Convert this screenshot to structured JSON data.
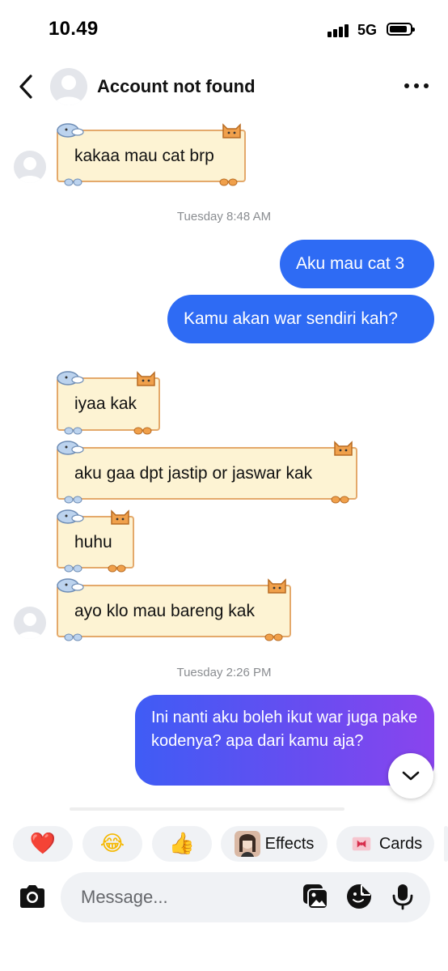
{
  "status": {
    "time": "10.49",
    "network": "5G"
  },
  "header": {
    "title": "Account not found"
  },
  "messages": {
    "m1": "kakaa mau cat brp",
    "ts1": "Tuesday 8:48 AM",
    "m2": "Aku mau cat 3",
    "m3": "Kamu akan war sendiri kah?",
    "m4": "iyaa kak",
    "m5": "aku gaa dpt jastip or jaswar kak",
    "m6": "huhu",
    "m7": "ayo klo mau bareng kak",
    "ts2": "Tuesday 2:26 PM",
    "m8": "Ini nanti aku boleh ikut war juga pake kodenya? apa dari kamu aja?"
  },
  "reactions": {
    "heart": "❤️",
    "laugh": "😂",
    "thumbs": "👍",
    "effects_label": "Effects",
    "cards_label": "Cards"
  },
  "composer": {
    "placeholder": "Message..."
  },
  "colors": {
    "outgoing": "#2e6bf4",
    "card_bg": "#fdf3d3",
    "card_border": "#e4a96b"
  }
}
